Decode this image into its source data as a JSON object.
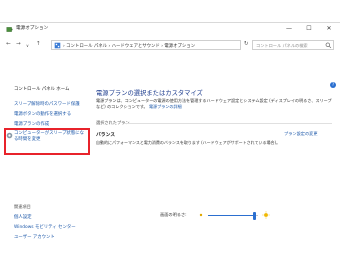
{
  "window": {
    "title": "電源オプション",
    "controls": {
      "minimize": "—",
      "maximize": "☐",
      "close": "✕"
    }
  },
  "address_bar": {
    "back": "←",
    "forward": "→",
    "up": "↑",
    "path": "› コントロール パネル › ハードウェアとサウンド › 電源オプション",
    "dropdown": "∨",
    "refresh": "↻",
    "search_placeholder": "コントロール パネルの検索"
  },
  "sidebar": {
    "home": "コントロール パネル ホーム",
    "items": [
      "スリープ解除時のパスワード保護",
      "電源ボタンの動作を選択する",
      "電源プランの作成",
      "コンピューターがスリープ状態になる時間を変更"
    ],
    "see_also_title": "関連項目",
    "see_also": [
      "個人設定",
      "Windows モビリティ センター",
      "ユーザー アカウント"
    ]
  },
  "main": {
    "title": "電源プランの選択またはカスタマイズ",
    "description": "電源プランは、コンピューターの電源の使用方法を管理するハードウェア設定とシステム設定 (ディスプレイの明るさ、スリープなど) のコレクションです。",
    "description_link": "電源プランの詳細",
    "section_label": "選択されたプラン",
    "plan": {
      "name": "バランス",
      "change_link": "プラン設定の変更",
      "description": "自動的にパフォーマンスと電力消費のバランスを取ります (ハードウェアがサポートされている場合)。"
    },
    "help_icon": "?"
  },
  "brightness": {
    "label": "画面の明るさ:",
    "level_percent": 92
  },
  "colors": {
    "link": "#1a56a8",
    "title": "#1e3d8f",
    "highlight": "#e8232b",
    "accent": "#2b6fd0"
  }
}
